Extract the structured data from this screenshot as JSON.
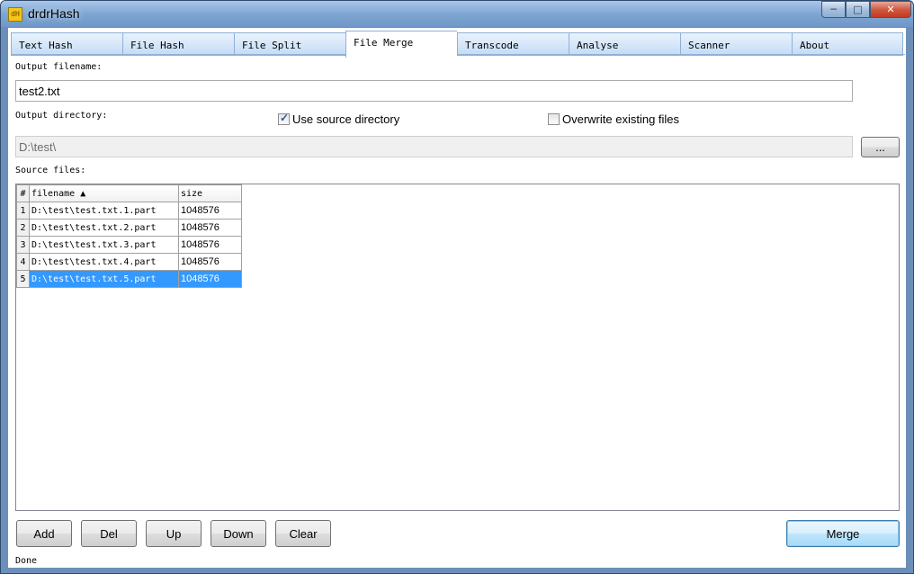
{
  "window": {
    "title": "drdrHash",
    "icon_text": "dH",
    "controls": {
      "minimize": "─",
      "maximize": "□",
      "close": "✕"
    }
  },
  "tabs": [
    {
      "label": "Text Hash",
      "active": false
    },
    {
      "label": "File Hash",
      "active": false
    },
    {
      "label": "File Split",
      "active": false
    },
    {
      "label": "File Merge",
      "active": true
    },
    {
      "label": "Transcode",
      "active": false
    },
    {
      "label": "Analyse",
      "active": false
    },
    {
      "label": "Scanner",
      "active": false
    },
    {
      "label": "About",
      "active": false
    }
  ],
  "merge": {
    "output_filename_label": "Output filename:",
    "output_filename_value": "test2.txt",
    "output_directory_label": "Output directory:",
    "use_source_directory_label": "Use source directory",
    "use_source_directory_checked": true,
    "overwrite_label": "Overwrite existing files",
    "overwrite_checked": false,
    "output_directory_value": "D:\\test\\",
    "browse_label": "...",
    "source_files_label": "Source files:",
    "columns": {
      "index": "#",
      "filename": "filename",
      "size": "size",
      "sort_indicator": "▲"
    },
    "rows": [
      {
        "index": "1",
        "filename": "D:\\test\\test.txt.1.part",
        "size": "1048576",
        "selected": false
      },
      {
        "index": "2",
        "filename": "D:\\test\\test.txt.2.part",
        "size": "1048576",
        "selected": false
      },
      {
        "index": "3",
        "filename": "D:\\test\\test.txt.3.part",
        "size": "1048576",
        "selected": false
      },
      {
        "index": "4",
        "filename": "D:\\test\\test.txt.4.part",
        "size": "1048576",
        "selected": false
      },
      {
        "index": "5",
        "filename": "D:\\test\\test.txt.5.part",
        "size": "1048576",
        "selected": true
      }
    ],
    "buttons": {
      "add": "Add",
      "del": "Del",
      "up": "Up",
      "down": "Down",
      "clear": "Clear",
      "merge": "Merge"
    }
  },
  "status": {
    "text": "Done"
  }
}
